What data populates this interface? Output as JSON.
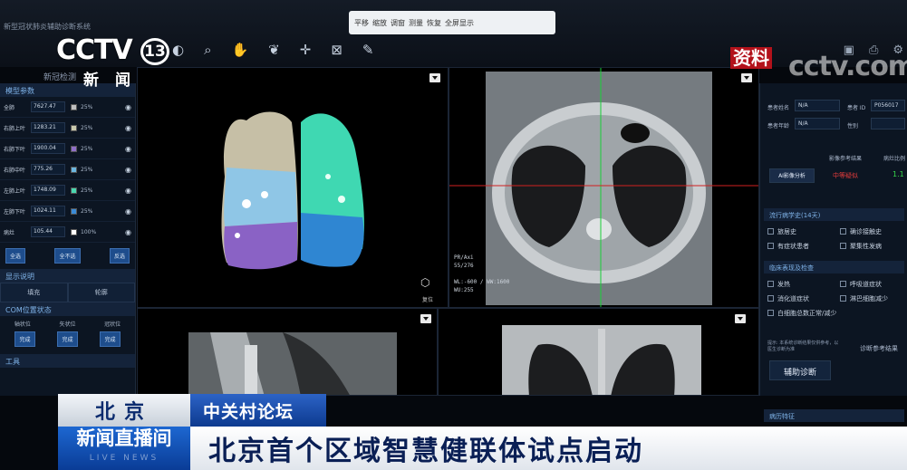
{
  "app": {
    "title": "新型冠状肺炎辅助诊断系统",
    "subtitle": "新冠检测"
  },
  "float_toolbar": {
    "items": [
      "平移",
      "缩放",
      "调窗",
      "测量",
      "恢复",
      "全屏显示"
    ]
  },
  "broadcast": {
    "channel_logo": "CCTV",
    "channel_number": "13",
    "channel_news": "新闻",
    "archive_badge": "资料",
    "site_watermark": "cctv.com",
    "location": "北京",
    "tag": "中关村论坛",
    "live_label": "新闻直播间",
    "live_sub": "LIVE NEWS",
    "headline": "北京首个区域智慧健联体试点启动"
  },
  "left_panel": {
    "section_params": "模型参数",
    "rows": [
      {
        "name": "全肺",
        "volume": "7627.47",
        "pct": "25%",
        "color": "#bfbfbf"
      },
      {
        "name": "右肺上叶",
        "volume": "1283.21",
        "pct": "25%",
        "color": "#c9c9ad"
      },
      {
        "name": "右肺下叶",
        "volume": "1900.04",
        "pct": "25%",
        "color": "#8f6fc8"
      },
      {
        "name": "右肺中叶",
        "volume": "775.26",
        "pct": "25%",
        "color": "#6bb6e0"
      },
      {
        "name": "左肺上叶",
        "volume": "1748.09",
        "pct": "25%",
        "color": "#49d7b0"
      },
      {
        "name": "左肺下叶",
        "volume": "1024.11",
        "pct": "25%",
        "color": "#3a8ad6"
      },
      {
        "name": "病灶",
        "volume": "105.44",
        "pct": "100%",
        "color": "#ffffff"
      }
    ],
    "buttons": [
      "全选",
      "全不选",
      "反选"
    ],
    "section_display": "显示说明",
    "mini_tabs": [
      "填充",
      "轮廓"
    ],
    "section_com": "COM位置状态",
    "positions": [
      "轴状位",
      "矢状位",
      "冠状位"
    ],
    "position_buttons": [
      "完成",
      "完成",
      "完成"
    ],
    "section_tools": "工具"
  },
  "viewport_ct": {
    "info": "PR/Axi\n55/276\n\nWL:-600 / WW:1600\nWU:255"
  },
  "viewport_3d": {
    "reset_label": "复位"
  },
  "right_panel": {
    "patient_name_label": "患者姓名",
    "patient_name_value": "N/A",
    "patient_id_label": "患者 ID",
    "patient_id_value": "P056017",
    "age_label": "患者年龄",
    "age_value": "N/A",
    "sex_label": "性别",
    "result_label": "影像参考结果",
    "risk_label": "病灶比例",
    "result_value": "中等疑似",
    "ratio_value": "1.1",
    "ai_button": "AI影像分析",
    "history_section": "流行病学史(14天)",
    "history_items": [
      "旅居史",
      "确诊接触史",
      "有症状患者",
      "聚集性发病"
    ],
    "clinical_section": "临床表现及检查",
    "clinical_items": [
      "发热",
      "呼吸道症状",
      "消化道症状",
      "淋巴细胞减少",
      "白细胞总数正常/减少"
    ],
    "note": "提示: 本系统诊断结果仅供参考，以医生诊断为准",
    "diag_ref": "诊断参考结果",
    "assist_button": "辅助诊断",
    "bottom_section": "病历特征"
  }
}
